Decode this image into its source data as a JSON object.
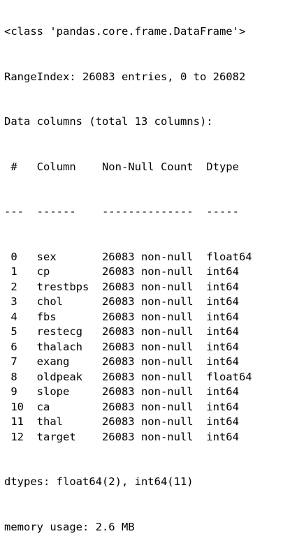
{
  "output": {
    "header": {
      "class_line": "<class 'pandas.core.frame.DataFrame'>",
      "range_index": "RangeIndex: 26083 entries, 0 to 26082",
      "columns_summary": "Data columns (total 13 columns):"
    },
    "table": {
      "headers": {
        "idx": "#",
        "column": "Column",
        "non_null": "Non-Null Count",
        "dtype": "Dtype"
      },
      "separators": {
        "idx": "---",
        "column": "------",
        "non_null": "--------------",
        "dtype": "-----"
      },
      "rows": [
        {
          "idx": "0",
          "column": "sex",
          "non_null": "26083 non-null",
          "dtype": "float64"
        },
        {
          "idx": "1",
          "column": "cp",
          "non_null": "26083 non-null",
          "dtype": "int64"
        },
        {
          "idx": "2",
          "column": "trestbps",
          "non_null": "26083 non-null",
          "dtype": "int64"
        },
        {
          "idx": "3",
          "column": "chol",
          "non_null": "26083 non-null",
          "dtype": "int64"
        },
        {
          "idx": "4",
          "column": "fbs",
          "non_null": "26083 non-null",
          "dtype": "int64"
        },
        {
          "idx": "5",
          "column": "restecg",
          "non_null": "26083 non-null",
          "dtype": "int64"
        },
        {
          "idx": "6",
          "column": "thalach",
          "non_null": "26083 non-null",
          "dtype": "int64"
        },
        {
          "idx": "7",
          "column": "exang",
          "non_null": "26083 non-null",
          "dtype": "int64"
        },
        {
          "idx": "8",
          "column": "oldpeak",
          "non_null": "26083 non-null",
          "dtype": "float64"
        },
        {
          "idx": "9",
          "column": "slope",
          "non_null": "26083 non-null",
          "dtype": "int64"
        },
        {
          "idx": "10",
          "column": "ca",
          "non_null": "26083 non-null",
          "dtype": "int64"
        },
        {
          "idx": "11",
          "column": "thal",
          "non_null": "26083 non-null",
          "dtype": "int64"
        },
        {
          "idx": "12",
          "column": "target",
          "non_null": "26083 non-null",
          "dtype": "int64"
        }
      ]
    },
    "footer": {
      "dtypes": "dtypes: float64(2), int64(11)",
      "memory_usage": "memory usage: 2.6 MB"
    }
  }
}
